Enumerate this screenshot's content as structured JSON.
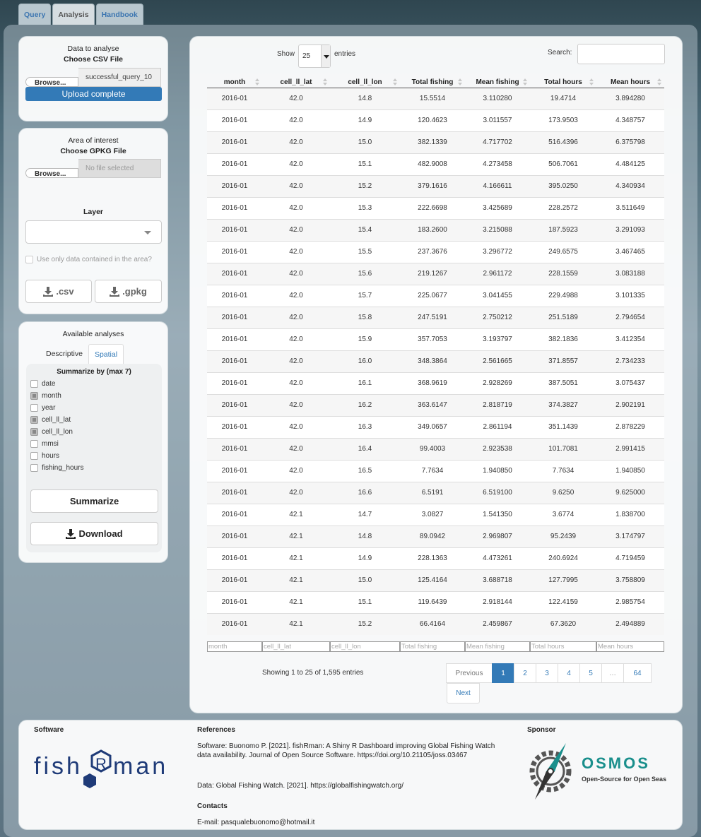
{
  "nav": {
    "tabs": [
      "Query",
      "Analysis",
      "Handbook"
    ],
    "active": "Analysis"
  },
  "data_panel": {
    "title": "Data to analyse",
    "subtitle": "Choose CSV File",
    "browse_label": "Browse...",
    "file_name": "successful_query_10",
    "progress_label": "Upload complete"
  },
  "area_panel": {
    "title": "Area of interest",
    "subtitle": "Choose GPKG File",
    "browse_label": "Browse...",
    "file_placeholder": "No file selected",
    "layer_label": "Layer",
    "checkbox_label": "Use only data contained in the area?",
    "csv_button": ".csv",
    "gpkg_button": ".gpkg"
  },
  "analyses_panel": {
    "title": "Available analyses",
    "tabs": [
      "Descriptive",
      "Spatial"
    ],
    "summarize_title": "Summarize by (max 7)",
    "variables": [
      {
        "label": "date",
        "checked": false
      },
      {
        "label": "month",
        "checked": true
      },
      {
        "label": "year",
        "checked": false
      },
      {
        "label": "cell_ll_lat",
        "checked": true
      },
      {
        "label": "cell_ll_lon",
        "checked": true
      },
      {
        "label": "mmsi",
        "checked": false
      },
      {
        "label": "hours",
        "checked": false
      },
      {
        "label": "fishing_hours",
        "checked": false
      }
    ],
    "summarize_button": "Summarize",
    "download_button": "Download"
  },
  "table": {
    "show_label": "Show",
    "entries_value": "25",
    "entries_label": "entries",
    "search_label": "Search:",
    "columns": [
      "month",
      "cell_ll_lat",
      "cell_ll_lon",
      "Total fishing",
      "Mean fishing",
      "Total hours",
      "Mean hours"
    ],
    "rows": [
      [
        "2016-01",
        "42.0",
        "14.8",
        "15.5514",
        "3.110280",
        "19.4714",
        "3.894280"
      ],
      [
        "2016-01",
        "42.0",
        "14.9",
        "120.4623",
        "3.011557",
        "173.9503",
        "4.348757"
      ],
      [
        "2016-01",
        "42.0",
        "15.0",
        "382.1339",
        "4.717702",
        "516.4396",
        "6.375798"
      ],
      [
        "2016-01",
        "42.0",
        "15.1",
        "482.9008",
        "4.273458",
        "506.7061",
        "4.484125"
      ],
      [
        "2016-01",
        "42.0",
        "15.2",
        "379.1616",
        "4.166611",
        "395.0250",
        "4.340934"
      ],
      [
        "2016-01",
        "42.0",
        "15.3",
        "222.6698",
        "3.425689",
        "228.2572",
        "3.511649"
      ],
      [
        "2016-01",
        "42.0",
        "15.4",
        "183.2600",
        "3.215088",
        "187.5923",
        "3.291093"
      ],
      [
        "2016-01",
        "42.0",
        "15.5",
        "237.3676",
        "3.296772",
        "249.6575",
        "3.467465"
      ],
      [
        "2016-01",
        "42.0",
        "15.6",
        "219.1267",
        "2.961172",
        "228.1559",
        "3.083188"
      ],
      [
        "2016-01",
        "42.0",
        "15.7",
        "225.0677",
        "3.041455",
        "229.4988",
        "3.101335"
      ],
      [
        "2016-01",
        "42.0",
        "15.8",
        "247.5191",
        "2.750212",
        "251.5189",
        "2.794654"
      ],
      [
        "2016-01",
        "42.0",
        "15.9",
        "357.7053",
        "3.193797",
        "382.1836",
        "3.412354"
      ],
      [
        "2016-01",
        "42.0",
        "16.0",
        "348.3864",
        "2.561665",
        "371.8557",
        "2.734233"
      ],
      [
        "2016-01",
        "42.0",
        "16.1",
        "368.9619",
        "2.928269",
        "387.5051",
        "3.075437"
      ],
      [
        "2016-01",
        "42.0",
        "16.2",
        "363.6147",
        "2.818719",
        "374.3827",
        "2.902191"
      ],
      [
        "2016-01",
        "42.0",
        "16.3",
        "349.0657",
        "2.861194",
        "351.1439",
        "2.878229"
      ],
      [
        "2016-01",
        "42.0",
        "16.4",
        "99.4003",
        "2.923538",
        "101.7081",
        "2.991415"
      ],
      [
        "2016-01",
        "42.0",
        "16.5",
        "7.7634",
        "1.940850",
        "7.7634",
        "1.940850"
      ],
      [
        "2016-01",
        "42.0",
        "16.6",
        "6.5191",
        "6.519100",
        "9.6250",
        "9.625000"
      ],
      [
        "2016-01",
        "42.1",
        "14.7",
        "3.0827",
        "1.541350",
        "3.6774",
        "1.838700"
      ],
      [
        "2016-01",
        "42.1",
        "14.8",
        "89.0942",
        "2.969807",
        "95.2439",
        "3.174797"
      ],
      [
        "2016-01",
        "42.1",
        "14.9",
        "228.1363",
        "4.473261",
        "240.6924",
        "4.719459"
      ],
      [
        "2016-01",
        "42.1",
        "15.0",
        "125.4164",
        "3.688718",
        "127.7995",
        "3.758809"
      ],
      [
        "2016-01",
        "42.1",
        "15.1",
        "119.6439",
        "2.918144",
        "122.4159",
        "2.985754"
      ],
      [
        "2016-01",
        "42.1",
        "15.2",
        "66.4164",
        "2.459867",
        "67.3620",
        "2.494889"
      ]
    ],
    "info": "Showing 1 to 25 of 1,595 entries",
    "pagination": {
      "previous": "Previous",
      "pages": [
        "1",
        "2",
        "3",
        "4",
        "5",
        "…",
        "64"
      ],
      "current": "1",
      "next": "Next"
    }
  },
  "footer": {
    "software_heading": "Software",
    "logo_text": "fishRman",
    "references_heading": "References",
    "reference_software": "Software: Buonomo P. [2021]. fishRman: A Shiny R Dashboard improving Global Fishing Watch data availability. Journal of Open Source Software. https://doi.org/10.21105/joss.03467",
    "reference_data": "Data: Global Fishing Watch. [2021]. https://globalfishingwatch.org/",
    "contacts_heading": "Contacts",
    "contact_email": "E-mail: pasqualebuonomo@hotmail.it",
    "sponsor_heading": "Sponsor",
    "sponsor_name": "OSMOS",
    "sponsor_tagline": "Open-Source for Open Seas"
  },
  "colors": {
    "accent": "#337ab7",
    "logo_navy": "#1f3b78",
    "osmos_teal": "#1a8f8c"
  }
}
